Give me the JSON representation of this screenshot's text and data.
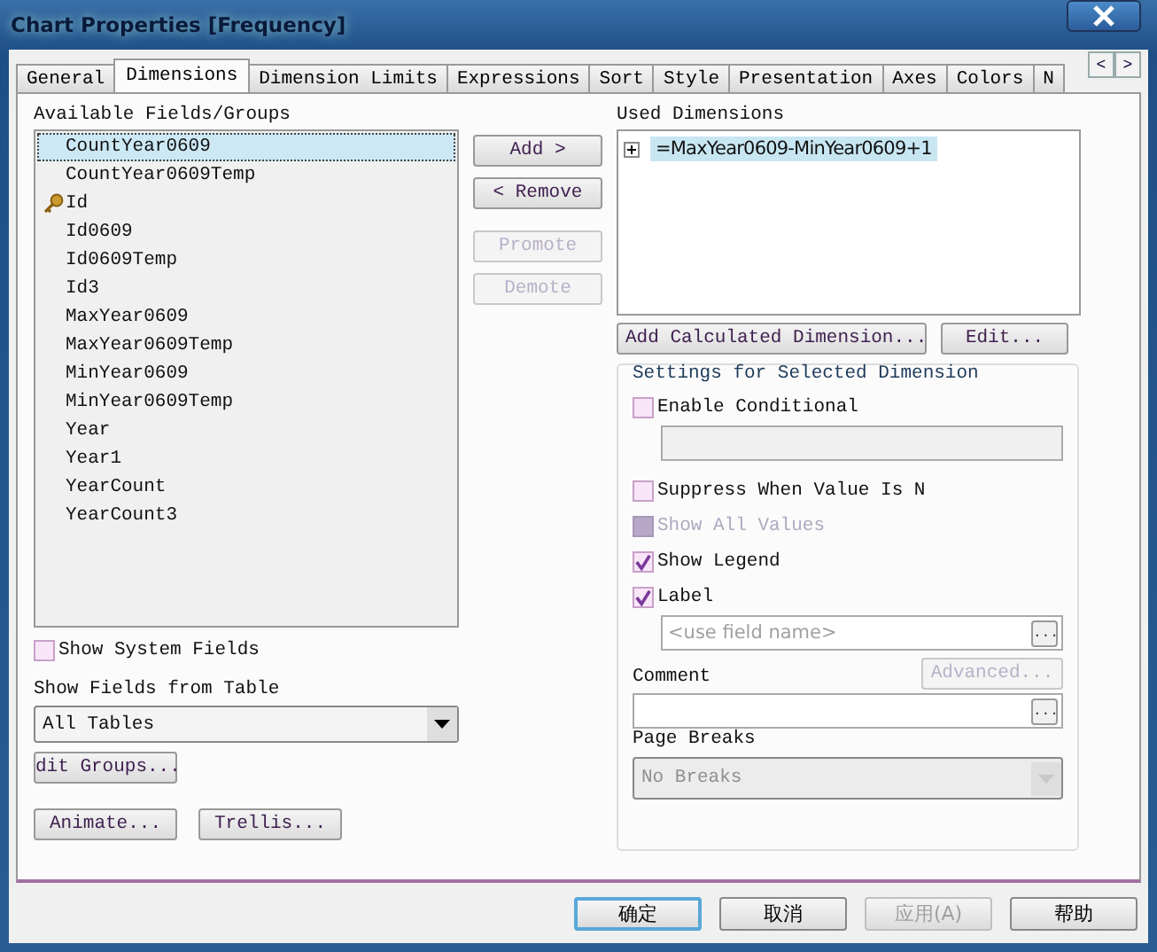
{
  "window": {
    "title": "Chart Properties [Frequency]"
  },
  "tabs": [
    {
      "label": "General",
      "selected": false
    },
    {
      "label": "Dimensions",
      "selected": true
    },
    {
      "label": "Dimension Limits",
      "selected": false
    },
    {
      "label": "Expressions",
      "selected": false
    },
    {
      "label": "Sort",
      "selected": false
    },
    {
      "label": "Style",
      "selected": false
    },
    {
      "label": "Presentation",
      "selected": false
    },
    {
      "label": "Axes",
      "selected": false
    },
    {
      "label": "Colors",
      "selected": false
    },
    {
      "label": "N",
      "selected": false
    }
  ],
  "tab_scroll": [
    "<",
    ">"
  ],
  "available_fields": {
    "label": "Available Fields/Groups",
    "items": [
      {
        "label": "CountYear0609",
        "kind": "field",
        "selected": true
      },
      {
        "label": "CountYear0609Temp",
        "kind": "field",
        "selected": false
      },
      {
        "label": "Id",
        "kind": "key",
        "selected": false
      },
      {
        "label": "Id0609",
        "kind": "field",
        "selected": false
      },
      {
        "label": "Id0609Temp",
        "kind": "field",
        "selected": false
      },
      {
        "label": "Id3",
        "kind": "field",
        "selected": false
      },
      {
        "label": "MaxYear0609",
        "kind": "field",
        "selected": false
      },
      {
        "label": "MaxYear0609Temp",
        "kind": "field",
        "selected": false
      },
      {
        "label": "MinYear0609",
        "kind": "field",
        "selected": false
      },
      {
        "label": "MinYear0609Temp",
        "kind": "field",
        "selected": false
      },
      {
        "label": "Year",
        "kind": "field",
        "selected": false
      },
      {
        "label": "Year1",
        "kind": "field",
        "selected": false
      },
      {
        "label": "YearCount",
        "kind": "field",
        "selected": false
      },
      {
        "label": "YearCount3",
        "kind": "field",
        "selected": false
      }
    ]
  },
  "move_buttons": [
    {
      "label": "Add >",
      "disabled": false
    },
    {
      "label": "< Remove",
      "disabled": false
    },
    {
      "label": "Promote",
      "disabled": true
    },
    {
      "label": "Demote",
      "disabled": true
    }
  ],
  "show_system_fields": {
    "label": "Show System Fields",
    "checked": false
  },
  "show_fields_from_table": {
    "label": "Show Fields from Table",
    "value": "All Tables"
  },
  "edit_groups_button": "dit Groups...",
  "lower_buttons": [
    "Animate...",
    "Trellis..."
  ],
  "used_dimensions": {
    "label": "Used Dimensions",
    "items": [
      {
        "label": "=MaxYear0609-MinYear0609+1",
        "selected": true,
        "expanded": false
      }
    ]
  },
  "dimension_buttons": [
    "Add Calculated Dimension...",
    "Edit..."
  ],
  "settings": {
    "title": "Settings for Selected Dimension",
    "options": [
      {
        "label": "Enable Conditional",
        "checked": false,
        "disabled": false,
        "field": {
          "disabled": true
        }
      },
      {
        "label": "Suppress When Value Is N",
        "checked": false,
        "disabled": false
      },
      {
        "label": "Show All Values",
        "checked": false,
        "disabled": true
      },
      {
        "label": "Show Legend",
        "checked": true,
        "disabled": false
      },
      {
        "label": "Label",
        "checked": true,
        "disabled": false,
        "field": {
          "disabled": false,
          "placeholder": "<use field name>",
          "browse": "..."
        }
      }
    ],
    "advanced_button": {
      "label": "Advanced...",
      "disabled": true
    },
    "comment": {
      "label": "Comment",
      "browse": "..."
    },
    "page_breaks": {
      "label": "Page Breaks",
      "value": "No Breaks",
      "disabled": true
    }
  },
  "footer_buttons": [
    {
      "label": "确定",
      "default": true,
      "disabled": false
    },
    {
      "label": "取消",
      "default": false,
      "disabled": false
    },
    {
      "label": "应用(A)",
      "default": false,
      "disabled": true
    },
    {
      "label": "帮助",
      "default": false,
      "disabled": false
    }
  ]
}
